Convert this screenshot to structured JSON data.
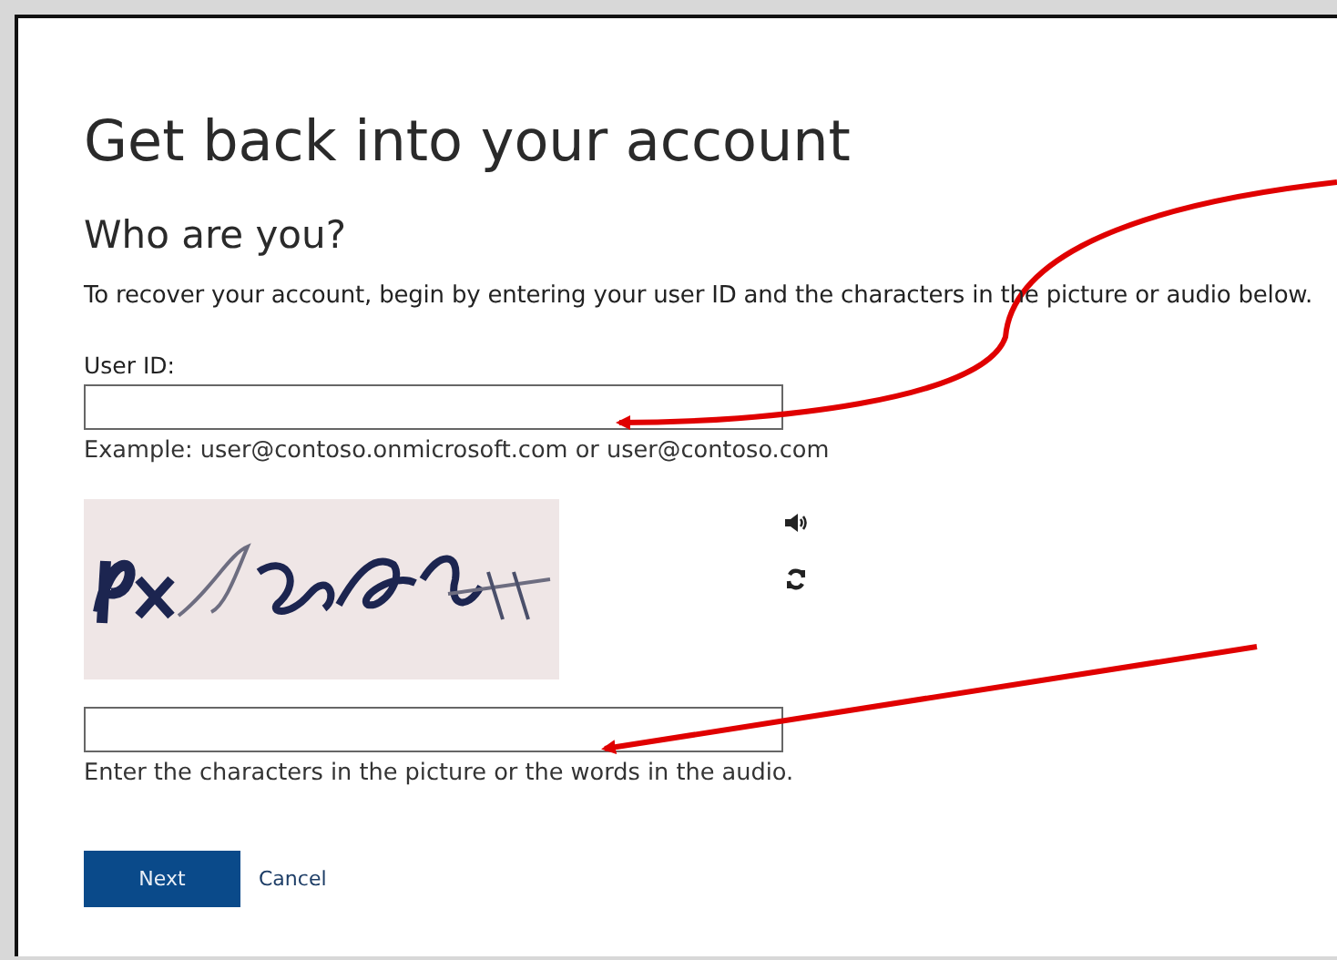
{
  "page": {
    "title": "Get back into your account",
    "subtitle": "Who are you?",
    "instruction": "To recover your account, begin by entering your user ID and the characters in the picture or audio below."
  },
  "user_id": {
    "label": "User ID:",
    "hint": "Example: user@contoso.onmicrosoft.com or user@contoso.com"
  },
  "captcha": {
    "kind": "picture",
    "answer_hint": "Enter the characters in the picture or the words in the audio."
  },
  "buttons": [
    {
      "label": "Next",
      "kind": "primary"
    },
    {
      "label": "Cancel",
      "kind": "link"
    }
  ]
}
